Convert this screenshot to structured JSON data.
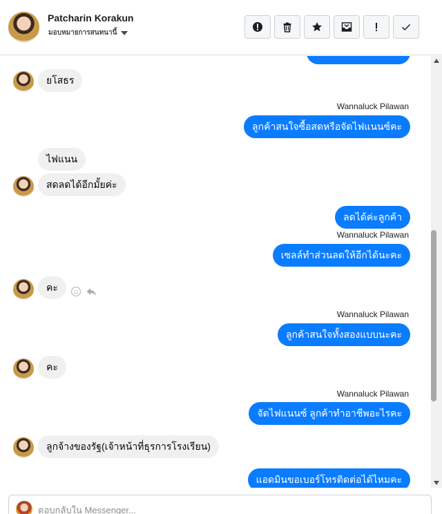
{
  "header": {
    "name": "Patcharin Korakun",
    "subtitle": "มอบหมายการสนทนานี้",
    "actions": [
      {
        "name": "report-icon",
        "label": "!"
      },
      {
        "name": "trash-icon",
        "label": ""
      },
      {
        "name": "star-icon",
        "label": ""
      },
      {
        "name": "archive-icon",
        "label": ""
      },
      {
        "name": "exclamation-icon",
        "label": "!"
      },
      {
        "name": "check-icon",
        "label": ""
      }
    ]
  },
  "messages": {
    "in_1": "ยโสธร",
    "sender_1": "Wannaluck Pilawan",
    "out_1": "ลูกค้าสนใจซื้อสดหรือจัดไฟแนนซ์คะ",
    "in_2": "ไฟแนน",
    "in_3": "สดลดได้อีกมั้ยค่ะ",
    "out_2": "ลดได้ค่ะลูกค้า",
    "sender_2": "Wannaluck Pilawan",
    "out_3": "เซลล์ทำส่วนลดให้อีกได้นะคะ",
    "in_4": "คะ",
    "sender_3": "Wannaluck Pilawan",
    "out_4": "ลูกค้าสนใจทั้งสองแบบนะคะ",
    "in_5": "คะ",
    "sender_4": "Wannaluck Pilawan",
    "out_5": "จัดไฟแนนซ์ ลูกค้าทำอาชีพอะไรคะ",
    "in_6": "ลูกจ้างของรัฐ(เจ้าหน้าที่ธุรการโรงเรียน)",
    "out_6": "แอดมินขอเบอร์โทรติดต่อได้ไหมคะ"
  },
  "composer": {
    "placeholder": "ตอบกลับใน Messenger..."
  },
  "colors": {
    "outgoing_bubble": "#0a7cff",
    "incoming_bubble": "#f0f0f0"
  }
}
